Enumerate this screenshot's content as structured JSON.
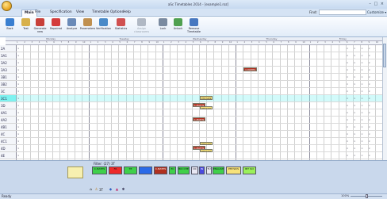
{
  "window": {
    "title": "aSc Timetables 2014 - [example1.roz]",
    "controls": "– □ ×"
  },
  "menu": [
    {
      "label": "Main",
      "active": true
    },
    {
      "label": "File"
    },
    {
      "label": "Specification"
    },
    {
      "label": "View"
    },
    {
      "label": "Timetable"
    },
    {
      "label": "Options"
    },
    {
      "label": "Help"
    }
  ],
  "find": {
    "label": "Find:",
    "value": ""
  },
  "customize_label": "Customize ▾",
  "ribbon": [
    {
      "label": "Back",
      "icon": "back-arrow-icon",
      "color": "#3a7fd0"
    },
    {
      "label": "Test",
      "icon": "test-person-icon",
      "color": "#d8b04a"
    },
    {
      "label": "Generate new",
      "icon": "generate-icon",
      "color": "#c8403a"
    },
    {
      "label": "Repaired",
      "icon": "repaired-icon",
      "color": "#d43c3c"
    },
    {
      "label": "Analyze",
      "icon": "analyze-icon",
      "color": "#6a8ab8"
    },
    {
      "label": "Parameters",
      "icon": "parameters-icon",
      "color": "#c09050"
    },
    {
      "label": "Verification",
      "icon": "verification-icon",
      "color": "#4a8ac8"
    },
    {
      "label": "Statistics",
      "icon": "statistics-pie-icon",
      "color": "#d05050"
    },
    {
      "label": "Assign classrooms",
      "icon": "assign-classrooms-icon",
      "color": "#b0b8c4",
      "disabled": true
    },
    {
      "label": "Lock",
      "icon": "lock-icon",
      "color": "#7a8aa0"
    },
    {
      "label": "Unlock",
      "icon": "unlock-icon",
      "color": "#50a050"
    },
    {
      "label": "Remove Timetable",
      "icon": "remove-timetable-icon",
      "color": "#4878c0"
    }
  ],
  "days": [
    "Monday",
    "Tuesday",
    "Wednesday",
    "Thursday",
    "Friday"
  ],
  "periods": [
    "1",
    "2",
    "3",
    "4",
    "5",
    "6",
    "7",
    "8",
    "9",
    "10"
  ],
  "rows": [
    "2A",
    "3A1",
    "3A2",
    "3A3",
    "3B1",
    "3B2",
    "3C",
    "3C1",
    "3D",
    "4A1",
    "4A2",
    "4B1",
    "4C",
    "4C1",
    "4D",
    "4E"
  ],
  "highlight_row": "3C1",
  "grid_activities": [
    {
      "label": "C-MATHS",
      "color": "#b03020",
      "text": "#fff"
    },
    {
      "label": "PHY.SICS",
      "color": "#f7e27a",
      "text": "#333"
    },
    {
      "label": "C-MATHS",
      "color": "#b03020",
      "text": "#fff"
    },
    {
      "label": "PHY.SICS",
      "color": "#f7e27a",
      "text": "#333"
    },
    {
      "label": "C-MATHS",
      "color": "#b03020",
      "text": "#fff"
    },
    {
      "label": "PHY.SICS",
      "color": "#f7e27a",
      "text": "#333"
    },
    {
      "label": "C-MATHS",
      "color": "#b03020",
      "text": "#fff"
    },
    {
      "label": "PHY.SICS",
      "color": "#f7e27a",
      "text": "#333"
    }
  ],
  "filter_label": "Filter: (27) 3T",
  "panel_activities": [
    {
      "label": "C-MATHS",
      "color": "#3fd04a"
    },
    {
      "label": "FR",
      "color": "#ee2a2a"
    },
    {
      "label": "TE",
      "color": "#3fd04a"
    },
    {
      "label": "",
      "color": "#2a6ae8"
    },
    {
      "label": "C-MATHS",
      "color": "#b03020"
    },
    {
      "label": "EC",
      "color": "#3fd04a"
    },
    {
      "label": "BIO CHE",
      "color": "#3fd04a"
    },
    {
      "label": "OC",
      "color": "#e8e8f4"
    },
    {
      "label": "IN",
      "color": "#4a4ae0"
    },
    {
      "label": "TU",
      "color": "#e8e8f4"
    },
    {
      "label": "ENGLISH",
      "color": "#3fd04a"
    },
    {
      "label": "PHY.SICS",
      "color": "#f7e27a"
    },
    {
      "label": "BIT SCI",
      "color": "#9af05a"
    }
  ],
  "nav_label": "3T",
  "status": {
    "text": "Ready",
    "zoom": "100%"
  },
  "colors": {
    "highlight": "#7ef2f0",
    "day_line": "#8a8a9a"
  }
}
